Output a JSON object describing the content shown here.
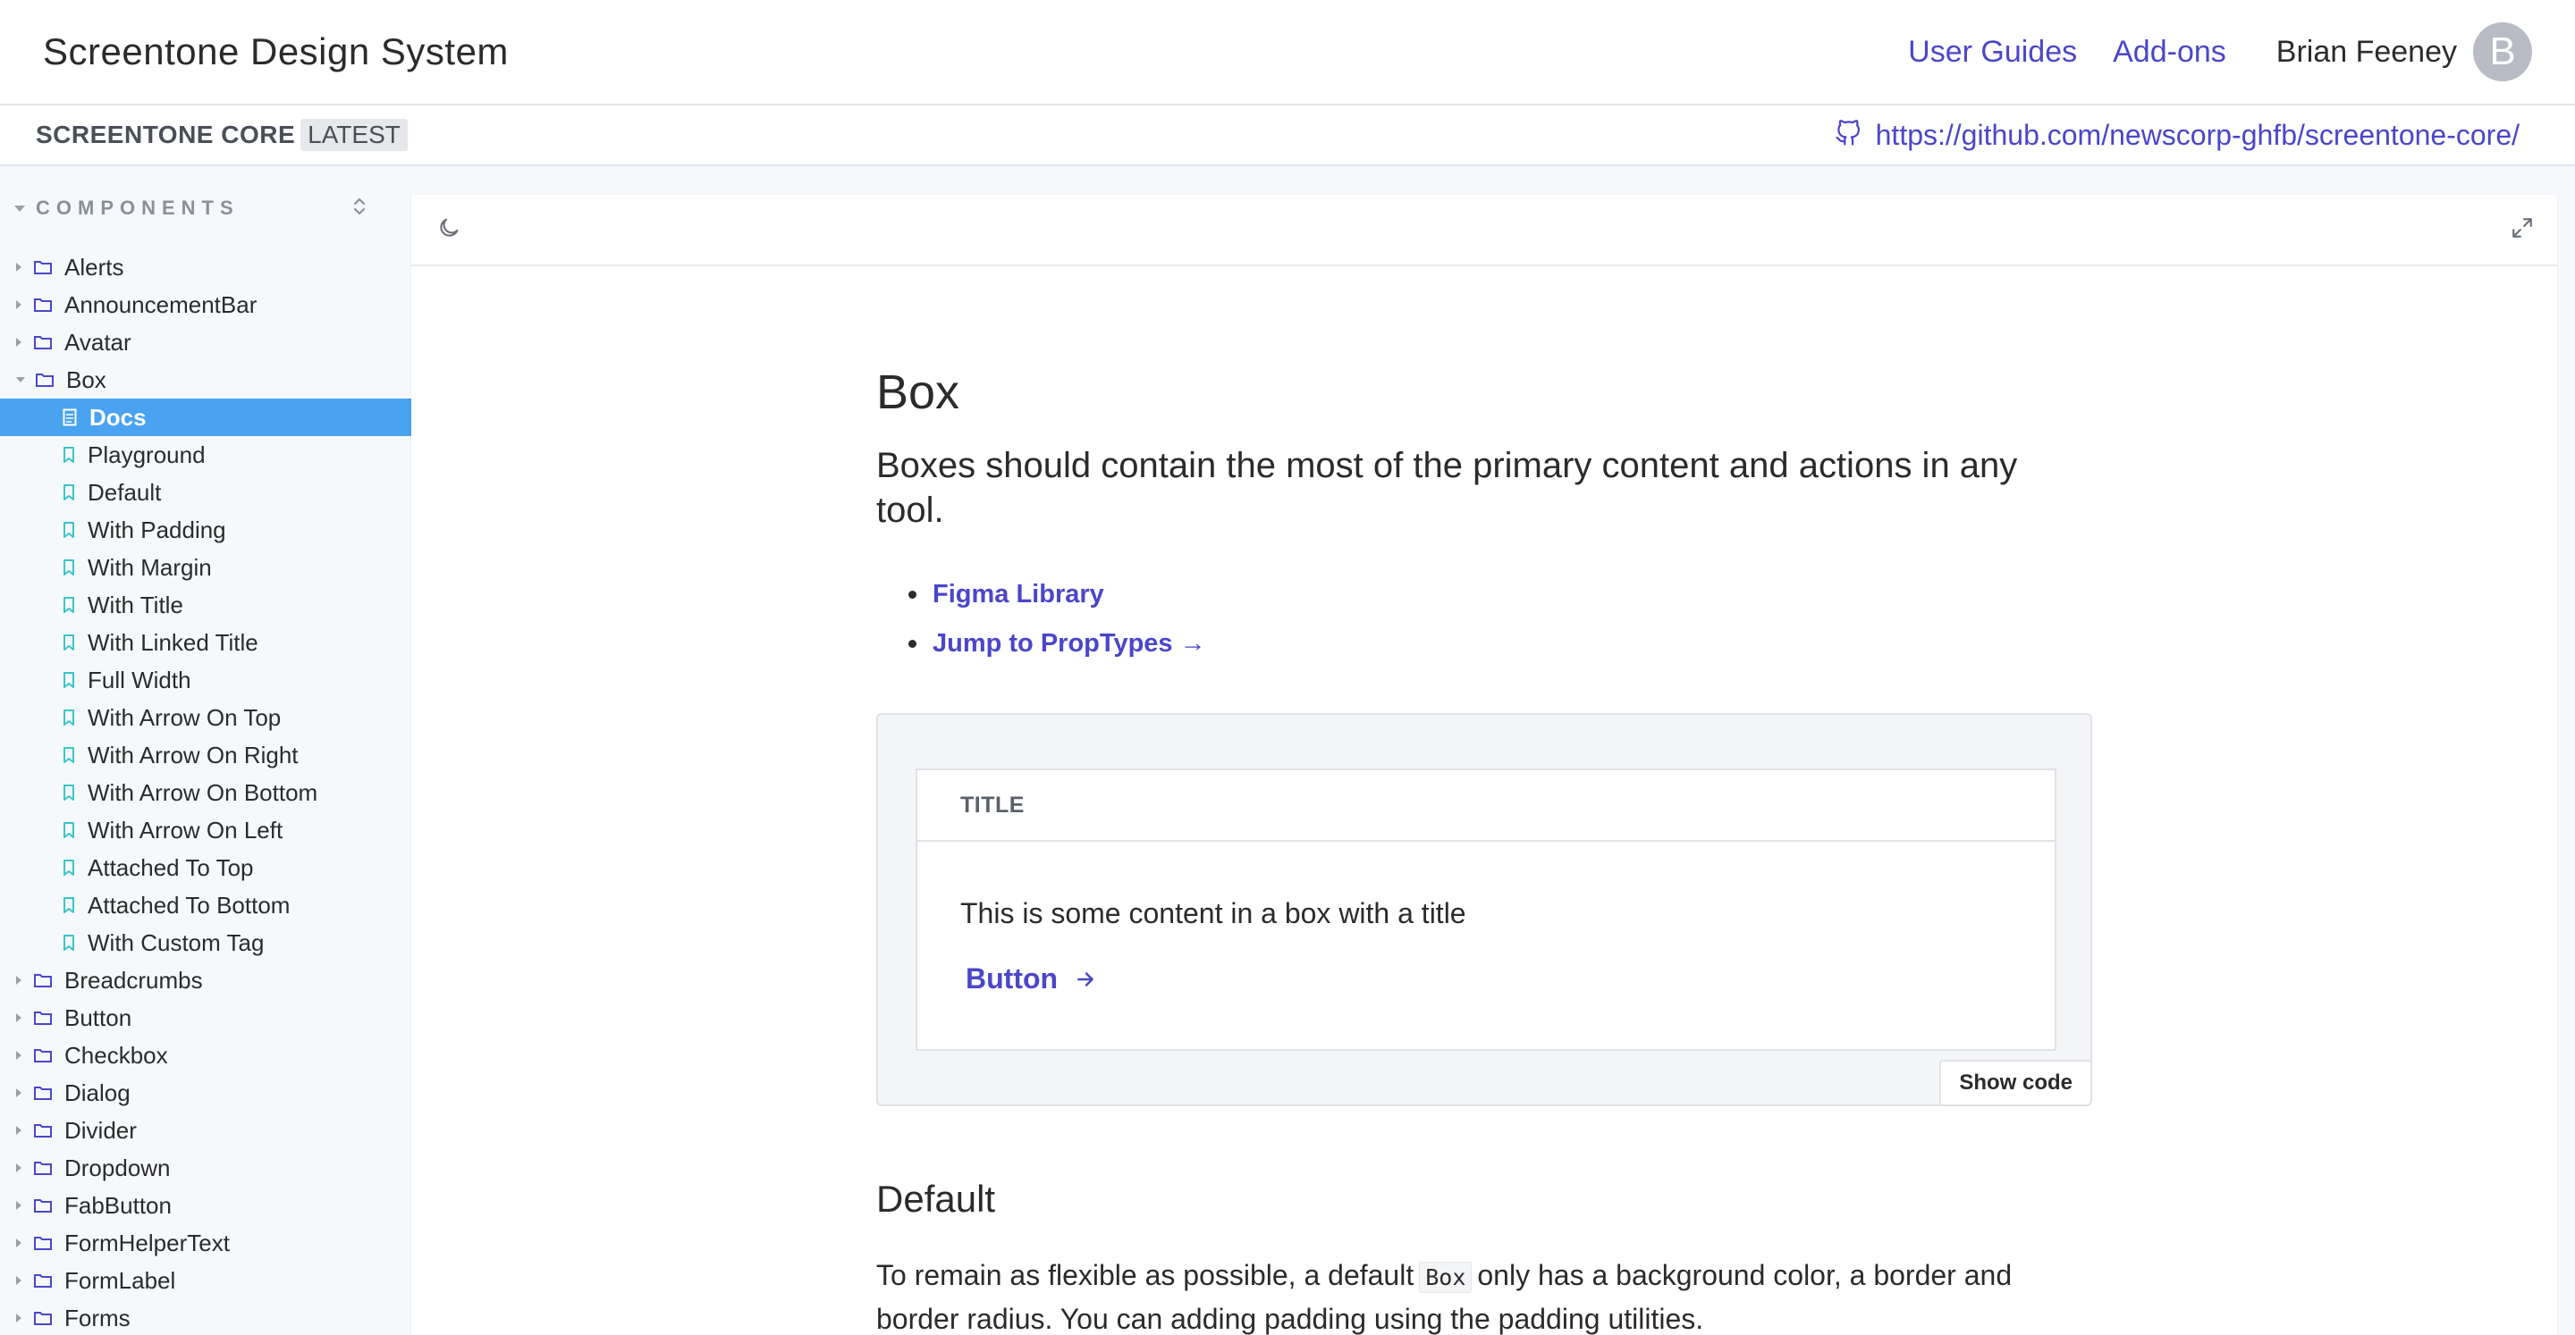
{
  "header": {
    "title": "Screentone Design System",
    "links": [
      "User Guides",
      "Add-ons"
    ],
    "user_name": "Brian Feeney",
    "avatar_letter": "B"
  },
  "subheader": {
    "package": "SCREENTONE CORE",
    "badge": "LATEST",
    "repo_url": "https://github.com/newscorp-ghfb/screentone-core/"
  },
  "sidebar": {
    "section_label": "COMPONENTS",
    "items_before": [
      "Alerts",
      "AnnouncementBar",
      "Avatar"
    ],
    "open_folder": "Box",
    "selected_doc": "Docs",
    "stories": [
      "Playground",
      "Default",
      "With Padding",
      "With Margin",
      "With Title",
      "With Linked Title",
      "Full Width",
      "With Arrow On Top",
      "With Arrow On Right",
      "With Arrow On Bottom",
      "With Arrow On Left",
      "Attached To Top",
      "Attached To Bottom",
      "With Custom Tag"
    ],
    "items_after": [
      "Breadcrumbs",
      "Button",
      "Checkbox",
      "Dialog",
      "Divider",
      "Dropdown",
      "FabButton",
      "FormHelperText",
      "FormLabel",
      "Forms"
    ]
  },
  "doc": {
    "title": "Box",
    "lead": "Boxes should contain the most of the primary content and actions in any tool.",
    "links": [
      "Figma Library",
      "Jump to PropTypes →"
    ],
    "demo": {
      "box_title": "TITLE",
      "box_content": "This is some content in a box with a title",
      "button_label": "Button",
      "show_code": "Show code"
    },
    "section_heading": "Default",
    "para_before": "To remain as flexible as possible, a default",
    "para_code": "Box",
    "para_after": "only has a background color, a border and border radius. You can adding padding using the padding utilities."
  },
  "colors": {
    "accent": "#4b46c9",
    "selected": "#49a3f0",
    "story_icon": "#37c6c9"
  }
}
